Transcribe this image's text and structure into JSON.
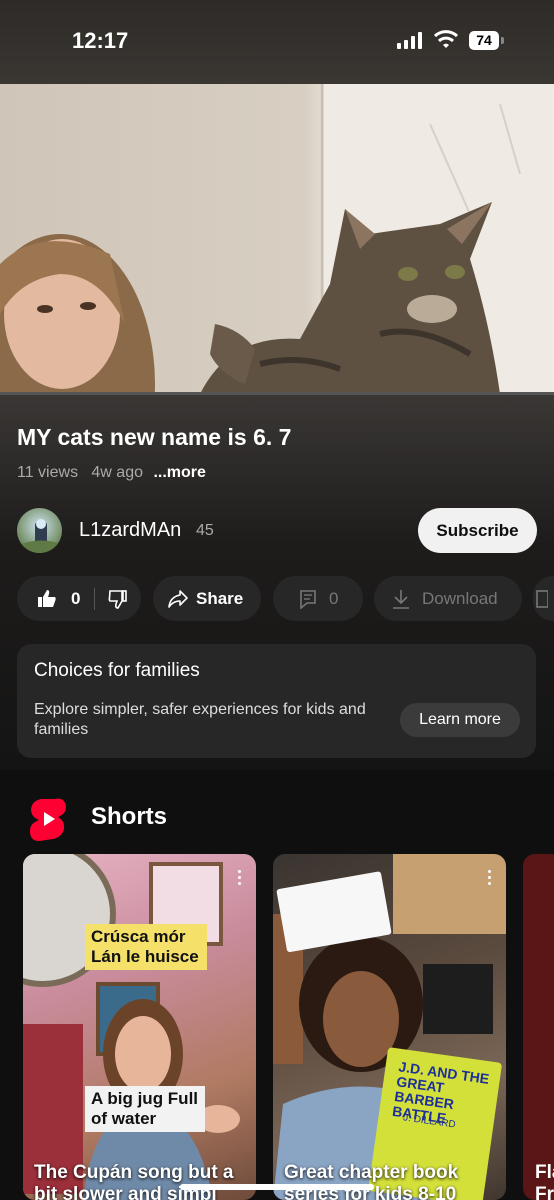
{
  "status_bar": {
    "time": "12:17",
    "battery": "74"
  },
  "video": {
    "title": "MY cats new name is 6. 7",
    "views": "11 views",
    "age": "4w ago",
    "more_label": "...more"
  },
  "channel": {
    "name": "L1zardMAn",
    "subscribers": "45",
    "subscribe_label": "Subscribe"
  },
  "actions": {
    "likes": "0",
    "share_label": "Share",
    "comments": "0",
    "download_label": "Download"
  },
  "families_card": {
    "title": "Choices for families",
    "description": "Explore simpler, safer experiences for kids and families",
    "button_label": "Learn more"
  },
  "shorts": {
    "section_title": "Shorts",
    "items": [
      {
        "title": "The Cupán song but a bit slower and simpl",
        "caption_top": "Crúsca mór Lán le huisce",
        "caption_bottom": "A big jug Full of water"
      },
      {
        "title": "Great chapter book series for kids 8-10",
        "book_title": "J.D. AND THE GREAT BARBER BATTLE",
        "book_author": "J. DILLARD"
      },
      {
        "title": "Fla Fr"
      }
    ]
  },
  "colors": {
    "background": "#0f0f0f",
    "shorts_red": "#ff0033",
    "pill": "#272727"
  }
}
